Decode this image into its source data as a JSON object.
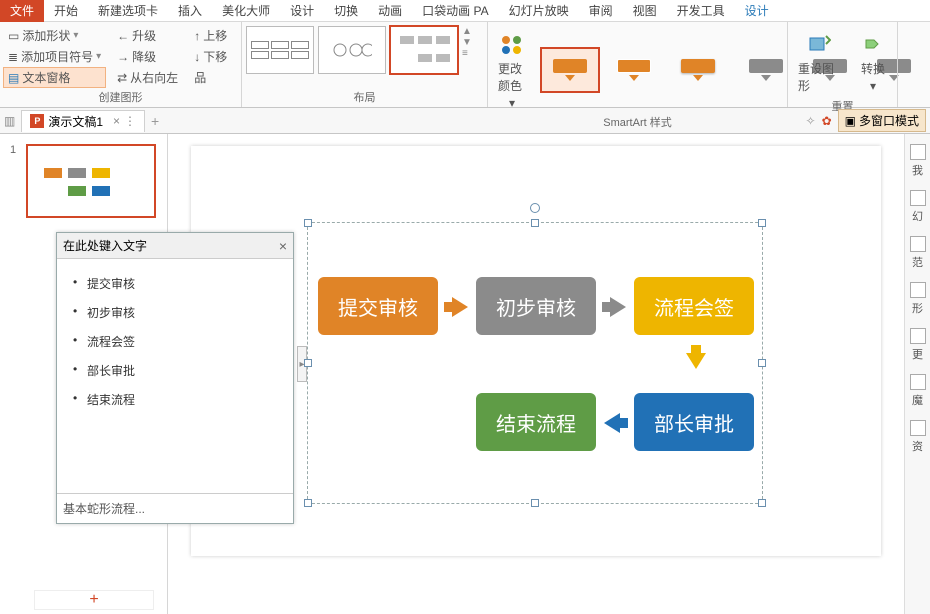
{
  "tabs": {
    "file": "文件",
    "items": [
      "开始",
      "新建选项卡",
      "插入",
      "美化大师",
      "设计",
      "切换",
      "动画",
      "口袋动画 PA",
      "幻灯片放映",
      "审阅",
      "视图",
      "开发工具",
      "设计"
    ]
  },
  "ribbon": {
    "createShape": {
      "addShape": "添加形状",
      "addBullet": "添加项目符号",
      "textPane": "文本窗格",
      "promote": "升级",
      "demote": "降级",
      "ltr": "从右向左",
      "moveUp": "上移",
      "moveDown": "下移",
      "groupLabel": "创建图形"
    },
    "layout": {
      "groupLabel": "布局"
    },
    "changeColors": "更改颜色",
    "styles": {
      "groupLabel": "SmartArt 样式"
    },
    "reset": {
      "resetGraphic": "重设图形",
      "convert": "转换",
      "groupLabel": "重置"
    }
  },
  "docbar": {
    "docTitle": "演示文稿1",
    "multiWindow": "多窗口模式"
  },
  "thumbs": {
    "slideNum": "1"
  },
  "textpane": {
    "title": "在此处键入文字",
    "items": [
      "提交审核",
      "初步审核",
      "流程会签",
      "部长审批",
      "结束流程"
    ],
    "footer": "基本蛇形流程..."
  },
  "nodes": {
    "n1": "提交审核",
    "n2": "初步审核",
    "n3": "流程会签",
    "n4": "部长审批",
    "n5": "结束流程"
  },
  "colors": {
    "orange": "#e08427",
    "gray": "#8b8b8b",
    "yellow": "#eeb500",
    "blue": "#2171b6",
    "green": "#5f9c46"
  },
  "rightbar": [
    "我",
    "幻",
    "范",
    "形",
    "更",
    "魔",
    "资"
  ]
}
